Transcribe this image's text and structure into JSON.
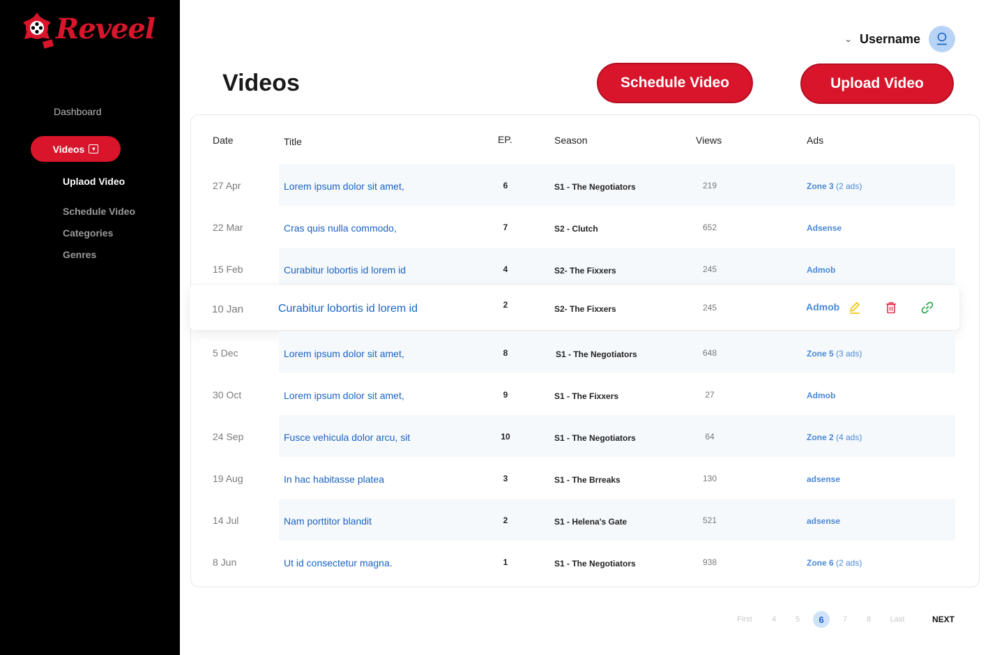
{
  "brand": {
    "name": "Reveel",
    "color": "#d8152b"
  },
  "sidebar": {
    "dashboard": "Dashboard",
    "videos": "Videos",
    "sub_items": [
      "Uplaod Video",
      "Schedule Video",
      "Categories",
      "Genres"
    ]
  },
  "header": {
    "username": "Username",
    "title": "Videos",
    "schedule_btn": "Schedule Video",
    "upload_btn": "Upload Video"
  },
  "table": {
    "columns": [
      "Date",
      "Title",
      "EP.",
      "Season",
      "Views",
      "Ads"
    ],
    "rows": [
      {
        "date": "27 Apr",
        "title": "Lorem ipsum dolor sit amet,",
        "ep": "6",
        "season": "S1 - The Negotiators",
        "views": "219",
        "ads": "Zone 3",
        "ads_extra": " (2 ads)"
      },
      {
        "date": "22 Mar",
        "title": "Cras quis nulla commodo,",
        "ep": "7",
        "season": "S2 - Clutch",
        "views": "652",
        "ads": "Adsense",
        "ads_extra": ""
      },
      {
        "date": "15 Feb",
        "title": "Curabitur lobortis id lorem id",
        "ep": "4",
        "season": "S2- The Fixxers",
        "views": "245",
        "ads": "Admob",
        "ads_extra": ""
      },
      {
        "date": "10 Jan",
        "title": "Curabitur lobortis id lorem id",
        "ep": "2",
        "season": "S2- The Fixxers",
        "views": "245",
        "ads": "Admob",
        "ads_extra": ""
      },
      {
        "date": "5 Dec",
        "title": "Lorem ipsum dolor sit amet,",
        "ep": "8",
        "season": "S1 - The Negotiators",
        "views": "648",
        "ads": "Zone 5",
        "ads_extra": " (3 ads)"
      },
      {
        "date": "30 Oct",
        "title": "Lorem ipsum dolor sit amet,",
        "ep": "9",
        "season": "S1 - The Fixxers",
        "views": "27",
        "ads": "Admob",
        "ads_extra": ""
      },
      {
        "date": "24 Sep",
        "title": "Fusce vehicula dolor arcu, sit",
        "ep": "10",
        "season": "S1 - The Negotiators",
        "views": "64",
        "ads": "Zone 2",
        "ads_extra": " (4 ads)"
      },
      {
        "date": "19 Aug",
        "title": "In hac habitasse platea",
        "ep": "3",
        "season": "S1 - The Brreaks",
        "views": "130",
        "ads": "adsense",
        "ads_extra": ""
      },
      {
        "date": "14 Jul",
        "title": "Nam porttitor blandit",
        "ep": "2",
        "season": "S1 - Helena's Gate",
        "views": "521",
        "ads": "adsense",
        "ads_extra": ""
      },
      {
        "date": "8 Jun",
        "title": "Ut id consectetur magna.",
        "ep": "1",
        "season": "S1 - The Negotiators",
        "views": "938",
        "ads": "Zone 6",
        "ads_extra": " (2 ads)"
      }
    ]
  },
  "icons": {
    "edit": "pencil-icon",
    "delete": "trash-icon",
    "link": "link-icon"
  },
  "icon_colors": {
    "edit": "#f2c200",
    "delete": "#e0354a",
    "link": "#2aa84a"
  },
  "pagination": {
    "first": "First",
    "pages": [
      "4",
      "5",
      "6",
      "7",
      "8"
    ],
    "current": "6",
    "last": "Last",
    "next": "NEXT"
  }
}
